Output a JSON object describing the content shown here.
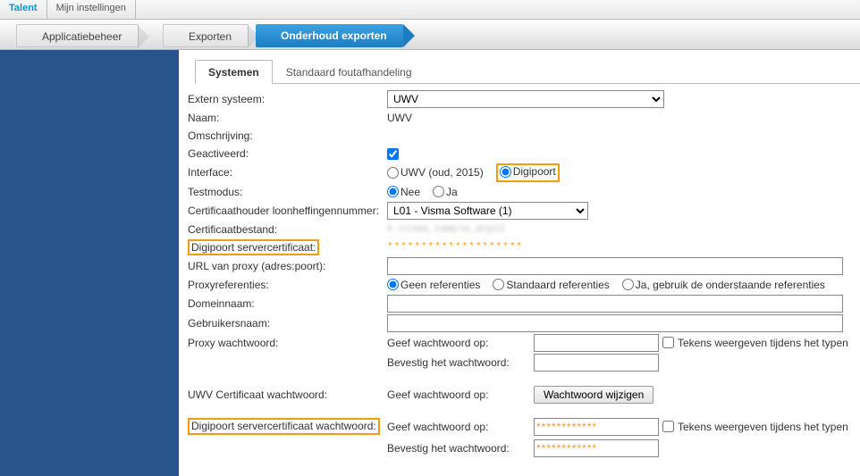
{
  "topbar": {
    "tabs": [
      {
        "label": "Talent",
        "active": true
      },
      {
        "label": "Mijn instellingen",
        "active": false
      }
    ]
  },
  "breadcrumbs": [
    {
      "label": "Applicatiebeheer",
      "active": false
    },
    {
      "label": "Exporten",
      "active": false
    },
    {
      "label": "Onderhoud exporten",
      "active": true
    }
  ],
  "innerTabs": [
    {
      "label": "Systemen",
      "active": true
    },
    {
      "label": "Standaard foutafhandeling",
      "active": false
    }
  ],
  "labels": {
    "externSysteem": "Extern systeem:",
    "naam": "Naam:",
    "omschrijving": "Omschrijving:",
    "geactiveerd": "Geactiveerd:",
    "interface": "Interface:",
    "testmodus": "Testmodus:",
    "certhouder": "Certificaathouder loonheffingennummer:",
    "certbestand": "Certificaatbestand:",
    "digipoortServerCert": "Digipoort servercertificaat:",
    "urlProxy": "URL van proxy (adres:poort):",
    "proxyRef": "Proxyreferenties:",
    "domeinnaam": "Domeinnaam:",
    "gebruikersnaam": "Gebruikersnaam:",
    "proxyWachtwoord": "Proxy wachtwoord:",
    "geefWachtwoord": "Geef wachtwoord op:",
    "bevestigWachtwoord": "Bevestig het wachtwoord:",
    "uwvCertWachtwoord": "UWV Certificaat wachtwoord:",
    "digipoortCertWachtwoord": "Digipoort servercertificaat wachtwoord:",
    "tekensWeergeven": "Tekens weergeven tijdens het typen"
  },
  "values": {
    "externSysteem": "UWV",
    "naam": "UWV",
    "omschrijving": "",
    "geactiveerd": true,
    "interface": {
      "options": [
        "UWV (oud, 2015)",
        "Digipoort"
      ],
      "selected": "Digipoort"
    },
    "testmodus": {
      "options": [
        "Nee",
        "Ja"
      ],
      "selected": "Nee"
    },
    "certhouder": "L01 - Visma Software (1)",
    "certbestand": "k-visma_sample_dcp12",
    "digipoortServerCert": "********************",
    "urlProxy": "",
    "proxyRef": {
      "options": [
        "Geen referenties",
        "Standaard referenties",
        "Ja, gebruik de onderstaande referenties"
      ],
      "selected": "Geen referenties"
    },
    "domeinnaam": "",
    "gebruikersnaam": "",
    "proxyPwd1": "",
    "proxyPwd2": "",
    "showProxyPwd": false,
    "btnWachtwoordWijzigen": "Wachtwoord wijzigen",
    "digipoortPwd1": "************",
    "digipoortPwd2": "************",
    "showDigipoortPwd": false
  }
}
